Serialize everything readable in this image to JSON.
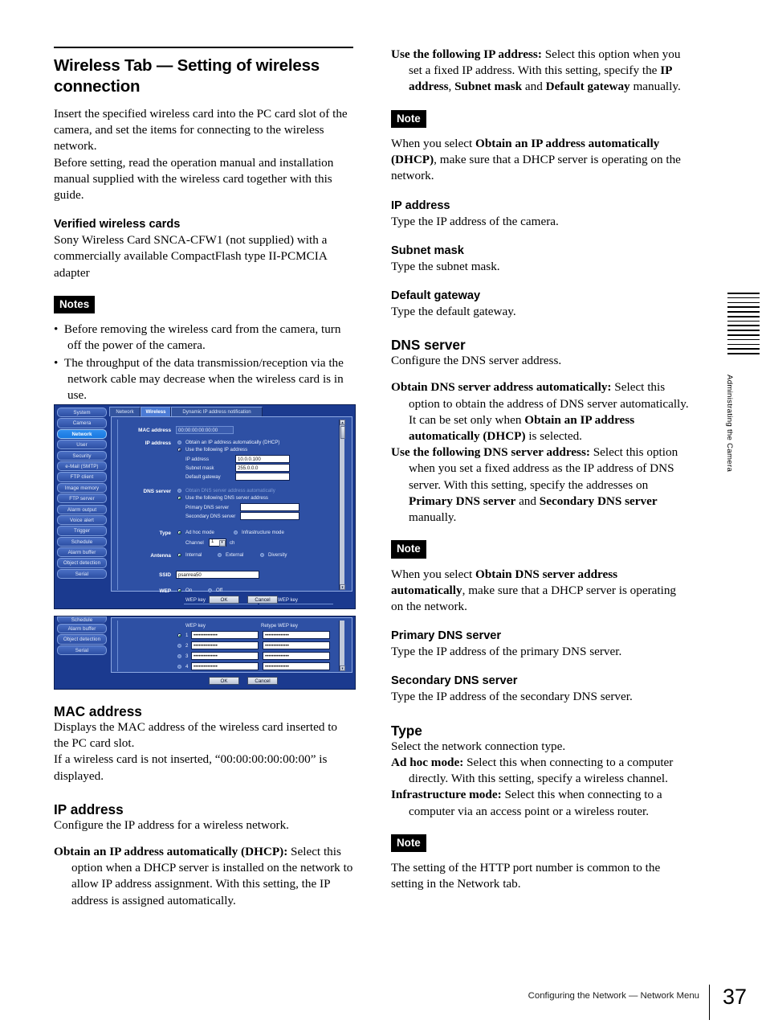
{
  "document": {
    "section_title": "Wireless Tab — Setting of wireless connection",
    "intro_p1": "Insert the specified wireless card into the PC card slot of the camera, and set the items for connecting to the wireless network.",
    "intro_p2": "Before setting, read the operation manual and installation manual supplied with the wireless card together with this guide.",
    "verified_heading": "Verified wireless cards",
    "verified_body": "Sony Wireless Card SNCA-CFW1 (not supplied) with a commercially available CompactFlash type II-PCMCIA adapter",
    "notes_tag": "Notes",
    "notes_items": [
      "Before removing the wireless card from the camera, turn off the power of the camera.",
      "The throughput of the data transmission/reception via the network cable may decrease when the wireless card is in use."
    ],
    "mac_heading": "MAC address",
    "mac_body_1": "Displays the MAC address of the wireless card inserted to the PC card slot.",
    "mac_body_2": "If a wireless card is not inserted, “00:00:00:00:00:00” is displayed.",
    "ip_heading": "IP address",
    "ip_body": "Configure the IP address for a wireless network.",
    "ip_dhcp_term": "Obtain an IP address automatically (DHCP):",
    "ip_dhcp_desc": " Select this option when a DHCP server is installed on the network to allow IP address assignment. With this setting, the IP address is assigned automatically.",
    "ip_fixed_term": "Use the following IP address:",
    "ip_fixed_desc_a": " Select this option when you set a fixed IP address. With this setting, specify the ",
    "ip_fixed_bold_1": "IP address",
    "ip_fixed_desc_b": ", ",
    "ip_fixed_bold_2": "Subnet mask",
    "ip_fixed_desc_c": " and ",
    "ip_fixed_bold_3": "Default gateway",
    "ip_fixed_desc_d": " manually.",
    "note_tag": "Note",
    "note_dhcp_a": "When you select ",
    "note_dhcp_b": "Obtain an IP address automatically (DHCP)",
    "note_dhcp_c": ", make sure that a DHCP server is operating on the network.",
    "ipaddr_heading": "IP address",
    "ipaddr_body": "Type the IP address of the camera.",
    "subnet_heading": "Subnet mask",
    "subnet_body": "Type the subnet mask.",
    "gateway_heading": "Default gateway",
    "gateway_body": "Type the default gateway.",
    "dns_heading": "DNS server",
    "dns_body": "Configure the DNS server address.",
    "dns_auto_term": "Obtain DNS server address automatically:",
    "dns_auto_desc_a": " Select this option to obtain the address of DNS server automatically. It can be set only when ",
    "dns_auto_bold": "Obtain an IP address automatically (DHCP)",
    "dns_auto_desc_b": " is selected.",
    "dns_fixed_term": "Use the following DNS server address:",
    "dns_fixed_desc_a": " Select this option when you set a fixed address as the IP address of DNS server. With this setting, specify the addresses on ",
    "dns_fixed_bold_1": "Primary DNS server",
    "dns_fixed_desc_b": " and ",
    "dns_fixed_bold_2": "Secondary DNS server",
    "dns_fixed_desc_c": " manually.",
    "note_dns_a": "When you select ",
    "note_dns_b": "Obtain DNS server address automatically",
    "note_dns_c": ", make sure that a DHCP server is operating on the network.",
    "primary_heading": "Primary DNS server",
    "primary_body": "Type the IP address of the primary DNS server.",
    "secondary_heading": "Secondary DNS server",
    "secondary_body": "Type the IP address of the secondary DNS server.",
    "type_heading": "Type",
    "type_body": "Select the network connection type.",
    "type_adhoc_term": "Ad hoc mode:",
    "type_adhoc_desc": " Select this when connecting to a computer directly. With this setting, specify a wireless channel.",
    "type_infra_term": "Infrastructure mode:",
    "type_infra_desc": " Select this when connecting to a computer via an access point or a wireless router.",
    "note_http": "The setting of the HTTP port number is common to the setting in the Network tab."
  },
  "margin": {
    "tab_label": "Administrating the Camera",
    "stripe_count": 14
  },
  "footer": {
    "breadcrumb": "Configuring the Network — Network Menu",
    "page_number": "37"
  },
  "screenshot1": {
    "sidebar": [
      {
        "label": "System",
        "active": false
      },
      {
        "label": "Camera",
        "active": false
      },
      {
        "label": "Network",
        "active": true
      },
      {
        "label": "User",
        "active": false
      },
      {
        "label": "Security",
        "active": false
      },
      {
        "label": "e-Mail (SMTP)",
        "active": false
      },
      {
        "label": "FTP client",
        "active": false
      },
      {
        "label": "Image memory",
        "active": false
      },
      {
        "label": "FTP server",
        "active": false
      },
      {
        "label": "Alarm output",
        "active": false
      },
      {
        "label": "Voice alert",
        "active": false
      },
      {
        "label": "Trigger",
        "active": false
      },
      {
        "label": "Schedule",
        "active": false
      },
      {
        "label": "Alarm buffer",
        "active": false
      },
      {
        "label": "Object detection",
        "active": false
      },
      {
        "label": "Serial",
        "active": false
      }
    ],
    "tabs": [
      {
        "label": "Network",
        "selected": false
      },
      {
        "label": "Wireless",
        "selected": true
      },
      {
        "label": "Dynamic IP address notification",
        "selected": false
      }
    ],
    "labels": {
      "mac_address": "MAC address",
      "ip_address": "IP address",
      "dns_server": "DNS server",
      "type": "Type",
      "antenna": "Antenna",
      "ssid": "SSID",
      "wep": "WEP"
    },
    "fields": {
      "mac_value": "00:00:00:00:00:00",
      "ip_radio_dhcp": "Obtain an IP address automatically (DHCP)",
      "ip_radio_fixed": "Use the following IP address",
      "ip_address_label": "IP address",
      "ip_address_value": "10.0.0.100",
      "subnet_label": "Subnet mask",
      "subnet_value": "255.0.0.0",
      "gateway_label": "Default gateway",
      "gateway_value": "",
      "dns_radio_auto": "Obtain DNS server address automatically",
      "dns_radio_fixed": "Use the following DNS server address",
      "primary_label": "Primary DNS server",
      "primary_value": "",
      "secondary_label": "Secondary DNS server",
      "secondary_value": "",
      "type_adhoc": "Ad hoc mode",
      "type_infra": "Infrastructure mode",
      "channel_label": "Channel",
      "channel_value": "1",
      "channel_unit": "ch",
      "antenna_internal": "Internal",
      "antenna_external": "External",
      "antenna_diversity": "Diversity",
      "ssid_value": "psanrea50",
      "wep_on": "On",
      "wep_off": "Off",
      "wep_key_header": "WEP key",
      "wep_retype_header": "Retype WEP key"
    },
    "buttons": {
      "ok": "OK",
      "cancel": "Cancel"
    }
  },
  "screenshot2": {
    "sidebar": [
      {
        "label": "Schedule",
        "active": false
      },
      {
        "label": "Alarm buffer",
        "active": false
      },
      {
        "label": "Object detection",
        "active": false
      },
      {
        "label": "Serial",
        "active": false
      }
    ],
    "headers": {
      "wep_key": "WEP key",
      "retype": "Retype WEP key"
    },
    "rows": [
      {
        "index": "1",
        "selected": true,
        "key": "••••••••••••••",
        "retype": "••••••••••••••"
      },
      {
        "index": "2",
        "selected": false,
        "key": "••••••••••••••",
        "retype": "••••••••••••••"
      },
      {
        "index": "3",
        "selected": false,
        "key": "••••••••••••••",
        "retype": "••••••••••••••"
      },
      {
        "index": "4",
        "selected": false,
        "key": "••••••••••••••",
        "retype": "••••••••••••••"
      }
    ],
    "buttons": {
      "ok": "OK",
      "cancel": "Cancel"
    }
  },
  "colors": {
    "ui_blue": "#1b3a8f",
    "ui_panel": "#2e50a4",
    "ui_active": "#1878e0",
    "note_tag_bg": "#000000"
  }
}
